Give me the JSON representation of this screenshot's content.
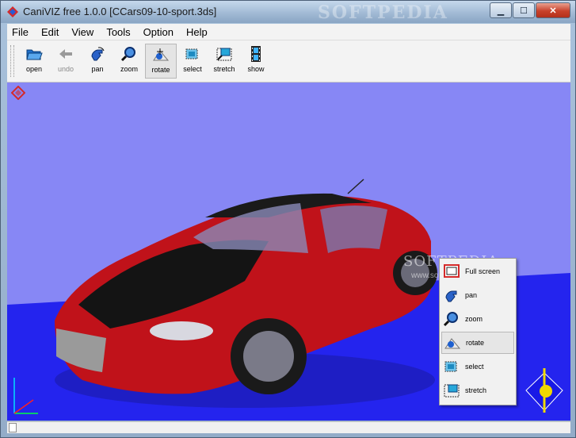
{
  "window": {
    "title": "CaniVIZ free 1.0.0 [CCars09-10-sport.3ds]",
    "watermark": "SOFTPEDIA",
    "minimize_glyph": "▁",
    "maximize_glyph": "☐",
    "close_glyph": "✕"
  },
  "menu": {
    "items": [
      "File",
      "Edit",
      "View",
      "Tools",
      "Option",
      "Help"
    ]
  },
  "toolbar": {
    "open_label": "open",
    "undo_label": "undo",
    "pan_label": "pan",
    "zoom_label": "zoom",
    "rotate_label": "rotate",
    "select_label": "select",
    "stretch_label": "stretch",
    "show_label": "show",
    "active_tool": "rotate"
  },
  "viewport": {
    "background_color": "#8787f5",
    "floor_color": "#2020f0",
    "car_color": "#c0121a",
    "watermark": "SOFTPEDIA",
    "watermark_url": "www.softpedia.com"
  },
  "context_menu": {
    "fullscreen_label": "Full screen",
    "pan_label": "pan",
    "zoom_label": "zoom",
    "rotate_label": "rotate",
    "select_label": "select",
    "stretch_label": "stretch",
    "checked_item": "rotate"
  },
  "icons": {
    "app": "caniviz-logo-icon",
    "open": "folder-open-icon",
    "undo": "arrow-left-icon",
    "pan": "hand-pan-icon",
    "zoom": "magnifier-icon",
    "rotate": "rotate-icon",
    "select": "select-box-icon",
    "stretch": "stretch-icon",
    "show": "film-strip-icon"
  }
}
